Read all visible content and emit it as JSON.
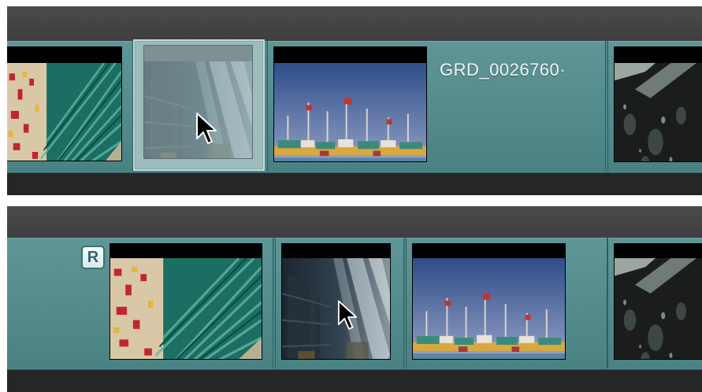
{
  "timeline_top": {
    "clip_title": "GRD_0026760·",
    "cursor": "arrow-pointer",
    "selected_clip": "warehouse-ghost-thumbnail"
  },
  "timeline_bottom": {
    "role_badge": "R",
    "cursor": "arrow-pointer"
  },
  "colors": {
    "lane": "#4e8688",
    "header": "#444444",
    "footer": "#262626",
    "selected_clip": "#9cbcbd",
    "clip_title": "#f1f6f6"
  },
  "icons": [
    "arrow-cursor-icon",
    "role-badge-icon"
  ]
}
